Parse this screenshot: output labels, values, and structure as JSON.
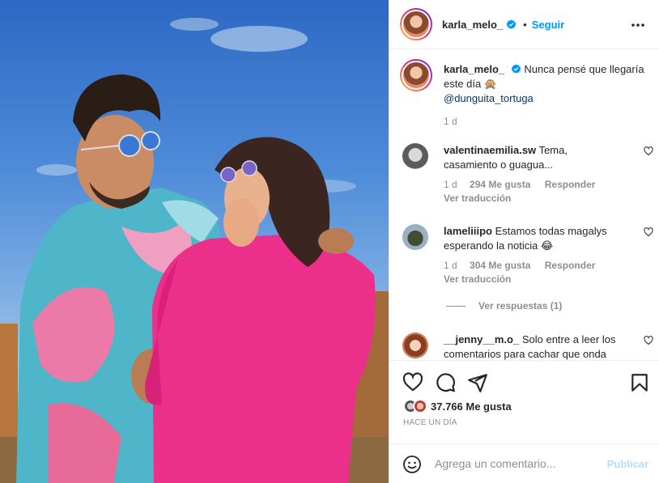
{
  "post": {
    "username": "karla_melo_",
    "follow_label": "Seguir",
    "separator": "•",
    "caption_text": "Nunca pensé que llegaría este día 🙊",
    "caption_mention": "@dunguita_tortuga",
    "caption_time": "1 d",
    "likes": "37.766 Me gusta",
    "posted_ago": "HACE UN DÍA"
  },
  "comments": [
    {
      "username": "valentinaemilia.sw",
      "text": "Tema, casamiento o guagua...",
      "time": "1 d",
      "likes": "294 Me gusta",
      "reply": "Responder",
      "translate": "Ver traducción"
    },
    {
      "username": "lameliiipo",
      "text": "Estamos todas magalys esperando la noticia 😂",
      "time": "1 d",
      "likes": "304 Me gusta",
      "reply": "Responder",
      "translate": "Ver traducción",
      "view_replies": "Ver respuestas (1)"
    },
    {
      "username": "__jenny__m.o_",
      "text": "Solo entre a leer los comentarios para cachar que onda"
    }
  ],
  "composer": {
    "placeholder": "Agrega un comentario...",
    "publish_label": "Publicar"
  },
  "colors": {
    "accent": "#0095f6",
    "text": "#262626",
    "muted": "#8e8e8e",
    "publish_disabled": "#b2dffc",
    "mention": "#00376b"
  },
  "icons": {
    "header": [
      "verified-badge-icon",
      "more-options-icon"
    ],
    "actions": [
      "heart-icon",
      "comment-icon",
      "share-icon",
      "bookmark-icon"
    ],
    "composer": [
      "emoji-icon"
    ]
  }
}
